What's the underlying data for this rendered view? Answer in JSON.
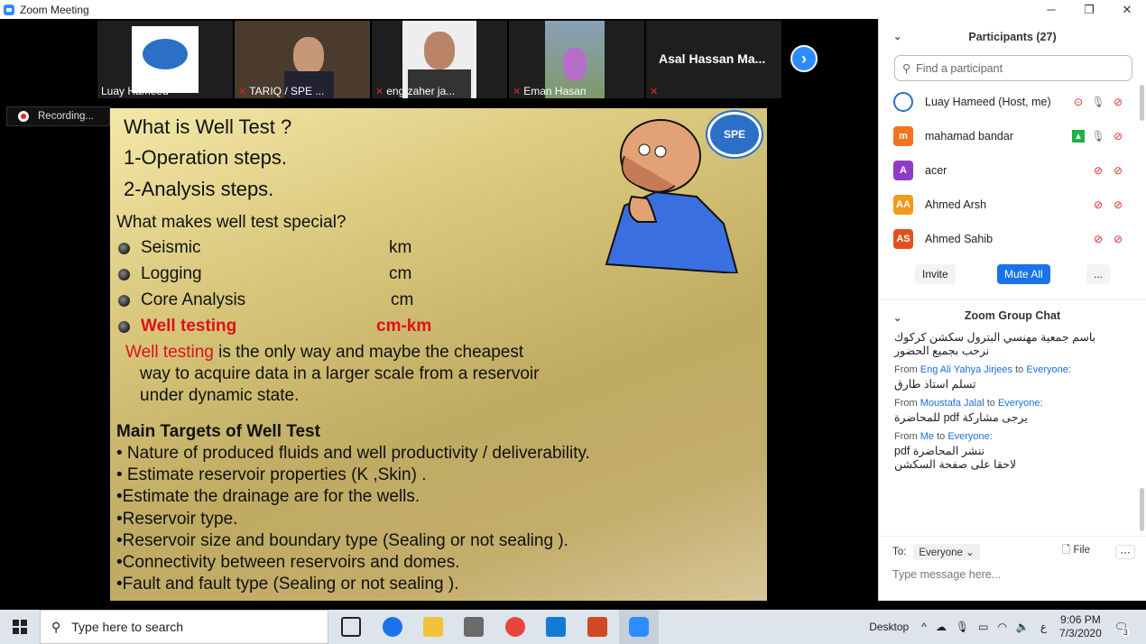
{
  "window": {
    "title": "Zoom Meeting",
    "minimize": "─",
    "maximize": "❐",
    "close": "✕"
  },
  "video": {
    "thumbnails": [
      {
        "name": "Luay Hameed",
        "muted": false
      },
      {
        "name": "TARIQ / SPE ...",
        "muted": true
      },
      {
        "name": "eng zaher ja...",
        "muted": true
      },
      {
        "name": "Eman Hasan",
        "muted": true
      },
      {
        "name": "",
        "muted": true
      }
    ],
    "featured_name": "Asal Hassan Ma...",
    "recording": "Recording..."
  },
  "slide": {
    "title": "What is  Well Test ?",
    "step1": "1-Operation steps.",
    "step2": "2-Analysis steps.",
    "special_heading": "What makes well test special?",
    "rows": [
      {
        "label": "Seismic",
        "scale": "km",
        "highlight": false
      },
      {
        "label": "Logging",
        "scale": "cm",
        "highlight": false
      },
      {
        "label": "Core Analysis",
        "scale": "cm",
        "highlight": false
      },
      {
        "label": "Well testing",
        "scale": "cm-km",
        "highlight": true
      }
    ],
    "para_red": "Well testing",
    "para_1": " is the only way  and maybe the cheapest",
    "para_2": "way to acquire data in a larger scale from a reservoir",
    "para_3": "under dynamic state.",
    "targets_heading": "Main Targets of Well Test",
    "targets": [
      "• Nature of produced fluids and well productivity / deliverability.",
      "• Estimate reservoir properties (K ,Skin) .",
      "•Estimate the drainage are for the wells.",
      "•Reservoir type.",
      "•Reservoir size and boundary type (Sealing or not sealing ).",
      "•Connectivity between reservoirs and domes.",
      "•Fault and fault type (Sealing or not sealing )."
    ],
    "logo_text": "SPE"
  },
  "participants": {
    "header": "Participants (27)",
    "search_placeholder": "Find a participant",
    "list": [
      {
        "name": "Luay Hameed (Host, me)",
        "initials": "",
        "color": "#ffffff"
      },
      {
        "name": "mahamad bandar",
        "initials": "m",
        "color": "#f4731e"
      },
      {
        "name": "acer",
        "initials": "A",
        "color": "#8e3bc8"
      },
      {
        "name": "Ahmed Arsh",
        "initials": "AA",
        "color": "#f29a1a"
      },
      {
        "name": "Ahmed Sahib",
        "initials": "AS",
        "color": "#e2511c"
      }
    ],
    "invite": "Invite",
    "mute_all": "Mute All",
    "more": "..."
  },
  "chat": {
    "header": "Zoom Group Chat",
    "messages": [
      {
        "from": "",
        "from_name": "",
        "to": "",
        "text_lines": [
          "باسم جمعية مهنسي البترول سكشن كركوك",
          "نرحب بجميع الحضور"
        ]
      },
      {
        "from": "From ",
        "from_name": "Eng Ali Yahya Jirjees",
        "to": "Everyone:",
        "text_lines": [
          "تسلم استاذ طارق"
        ]
      },
      {
        "from": "From ",
        "from_name": "Moustafa Jalal",
        "to": "Everyone:",
        "text_lines": [
          "يرجى مشاركة pdf للمحاضرة"
        ]
      },
      {
        "from": "From ",
        "from_name": "Me",
        "to": "Everyone:",
        "text_lines": [
          "ننشر المحاضرة pdf",
          "لاحقا على صفحة السكشن"
        ]
      }
    ],
    "to_label": "To:",
    "to_value": "Everyone",
    "file_label": "File",
    "input_placeholder": "Type message here..."
  },
  "taskbar": {
    "search_placeholder": "Type here to search",
    "desktop": "Desktop",
    "time": "9:06 PM",
    "date": "7/3/2020",
    "lang": "ع",
    "notifications": "3"
  }
}
